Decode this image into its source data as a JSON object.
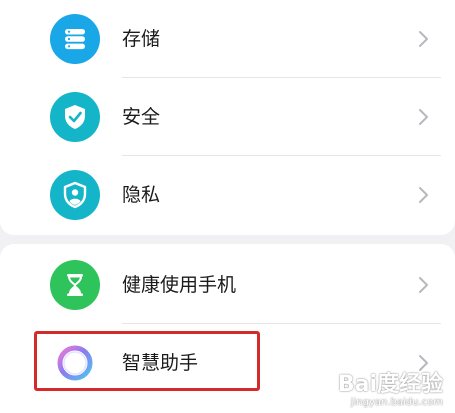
{
  "settings_list": {
    "items": [
      {
        "label": "存储",
        "icon": "storage-icon",
        "color": "#1aa7e8"
      },
      {
        "label": "安全",
        "icon": "shield-check-icon",
        "color": "#14b5c9"
      },
      {
        "label": "隐私",
        "icon": "privacy-shield-icon",
        "color": "#14b5c9"
      },
      {
        "label": "健康使用手机",
        "icon": "hourglass-icon",
        "color": "#2ec35b"
      },
      {
        "label": "智慧助手",
        "icon": "assistant-ring-icon",
        "color": "#8a7cf0"
      }
    ],
    "highlighted_item": "智慧助手"
  },
  "watermark": {
    "brand": "Bai度经验",
    "url": "jingyan.baidu.com"
  },
  "colors": {
    "background": "#f1f1f3",
    "card": "#ffffff",
    "highlight_border": "#d52a2a"
  }
}
